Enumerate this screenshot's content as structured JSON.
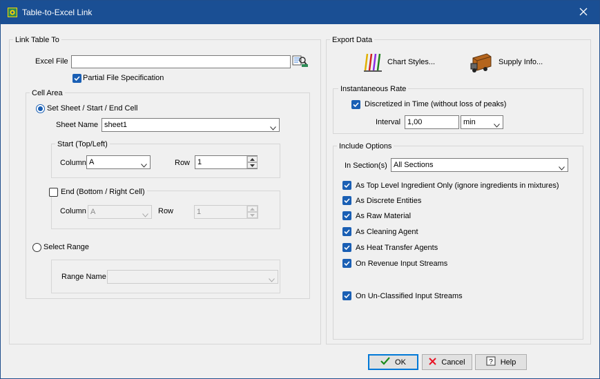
{
  "window": {
    "title": "Table-to-Excel Link",
    "icon": "app-icon",
    "close_icon": "close-icon"
  },
  "link_table_to": {
    "group_label": "Link Table To",
    "excel_file_label": "Excel File",
    "excel_file_value": "",
    "browse_icon": "file-browse-icon",
    "partial_spec_label": "Partial File Specification",
    "partial_spec_checked": true,
    "cell_area": {
      "group_label": "Cell Area",
      "set_sheet_label": "Set Sheet / Start / End Cell",
      "sheet_name_label": "Sheet Name",
      "sheet_name_value": "sheet1",
      "start_group_label": "Start (Top/Left)",
      "start_column_label": "Column",
      "start_column_value": "A",
      "start_row_label": "Row",
      "start_row_value": "1",
      "end_label": "End  (Bottom / Right Cell)",
      "end_checked": false,
      "end_column_label": "Column",
      "end_column_value": "A",
      "end_row_label": "Row",
      "end_row_value": "1",
      "select_range_label": "Select Range",
      "range_name_label": "Range Name",
      "range_name_value": ""
    }
  },
  "export_data": {
    "group_label": "Export Data",
    "chart_styles_label": "Chart Styles...",
    "supply_info_label": "Supply Info...",
    "instantaneous_rate": {
      "group_label": "Instantaneous Rate",
      "discretized_label": "Discretized in Time  (without loss of peaks)",
      "discretized_checked": true,
      "interval_label": "Interval",
      "interval_value": "1,00",
      "interval_unit": "min"
    },
    "include_options": {
      "group_label": "Include Options",
      "in_sections_label": "In Section(s)",
      "in_sections_value": "All Sections",
      "options": [
        {
          "label": "As Top Level Ingredient Only (ignore ingredients in mixtures)",
          "checked": true
        },
        {
          "label": "As Discrete Entities",
          "checked": true
        },
        {
          "label": "As Raw Material",
          "checked": true
        },
        {
          "label": "As Cleaning Agent",
          "checked": true
        },
        {
          "label": "As Heat Transfer Agents",
          "checked": true
        },
        {
          "label": "On Revenue Input Streams",
          "checked": true
        },
        {
          "label": "On Un-Classified Input Streams",
          "checked": true
        }
      ]
    }
  },
  "buttons": {
    "ok": "OK",
    "cancel": "Cancel",
    "help": "Help"
  },
  "colors": {
    "titlebar": "#1a4f94",
    "accent": "#1a5fb4",
    "cancel_x": "#e81123"
  }
}
